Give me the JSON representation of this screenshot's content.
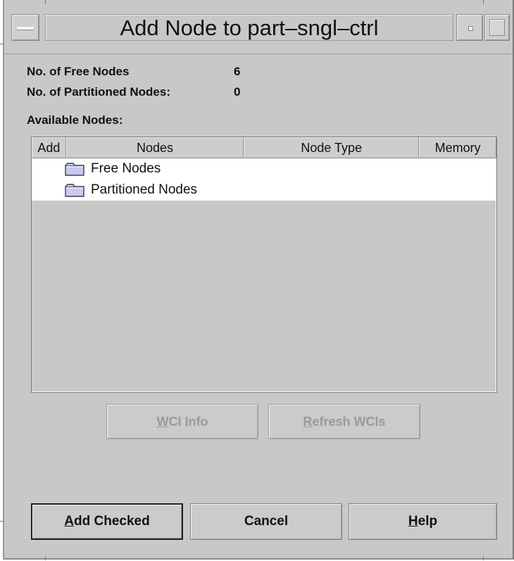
{
  "window": {
    "title": "Add Node to part–sngl–ctrl"
  },
  "info": {
    "free_nodes_label": "No. of Free Nodes",
    "free_nodes_value": "6",
    "partitioned_nodes_label": "No. of Partitioned Nodes:",
    "partitioned_nodes_value": "0",
    "available_label": "Available Nodes:"
  },
  "table": {
    "columns": [
      "Add",
      "Nodes",
      "Node Type",
      "Memory"
    ],
    "rows": [
      {
        "icon": "folder-icon",
        "label": "Free Nodes"
      },
      {
        "icon": "folder-icon",
        "label": "Partitioned Nodes"
      }
    ]
  },
  "buttons": {
    "wci_info": {
      "mnemonic": "W",
      "rest": "CI Info"
    },
    "refresh_wcis": {
      "mnemonic": "R",
      "rest": "efresh WCIs"
    },
    "add_checked": {
      "mnemonic": "A",
      "rest": "dd Checked"
    },
    "cancel": {
      "label": "Cancel"
    },
    "help": {
      "mnemonic": "H",
      "rest": "elp"
    }
  },
  "colors": {
    "dialog_background": "#c8c8c8",
    "list_background": "#ffffff",
    "disabled_text": "#9a9a9a"
  }
}
